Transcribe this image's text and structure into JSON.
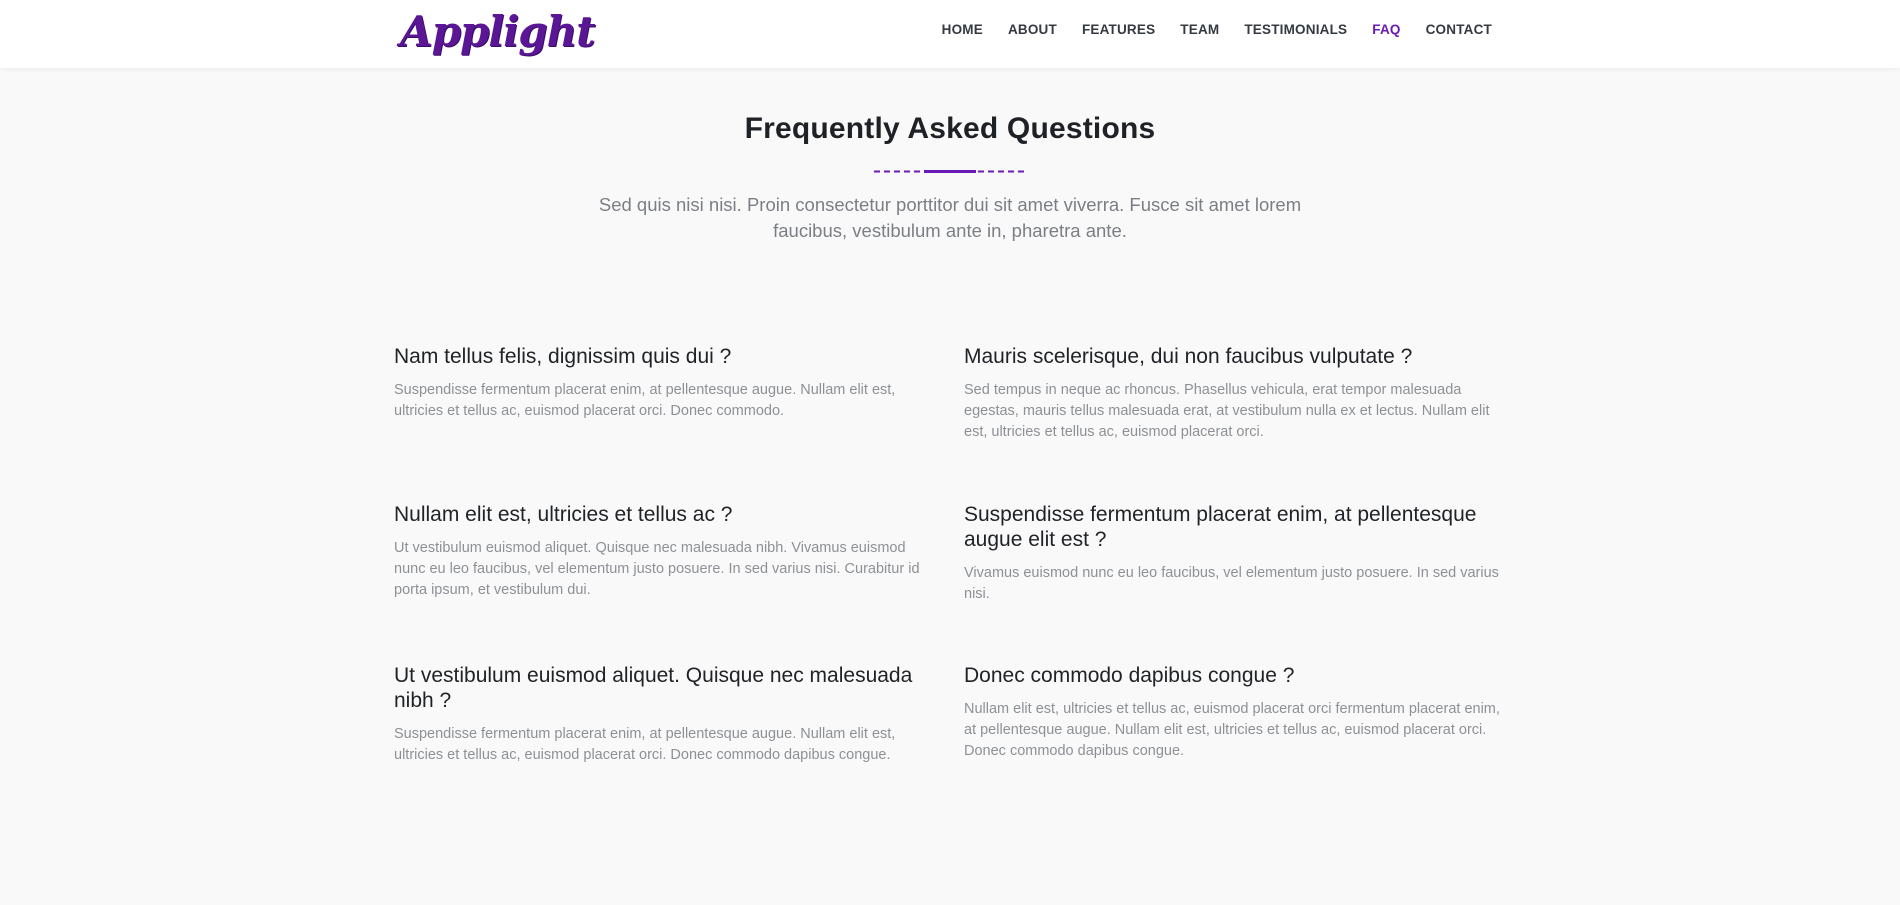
{
  "header": {
    "logo": "Applight",
    "nav": [
      {
        "label": "HOME",
        "active": false
      },
      {
        "label": "ABOUT",
        "active": false
      },
      {
        "label": "FEATURES",
        "active": false
      },
      {
        "label": "TEAM",
        "active": false
      },
      {
        "label": "TESTIMONIALS",
        "active": false
      },
      {
        "label": "FAQ",
        "active": true
      },
      {
        "label": "CONTACT",
        "active": false
      }
    ]
  },
  "colors": {
    "accent": "#6a1bb3",
    "logo": "#5b1696",
    "background": "#f9f9f9",
    "header_bg": "#ffffff",
    "muted_text": "#8d9196"
  },
  "section": {
    "title": "Frequently Asked Questions",
    "subtitle": "Sed quis nisi nisi. Proin consectetur porttitor dui sit amet viverra. Fusce sit amet lorem faucibus, vestibulum ante in, pharetra ante."
  },
  "faqs": [
    {
      "question": "Nam tellus felis, dignissim quis dui ?",
      "answer": "Suspendisse fermentum placerat enim, at pellentesque augue. Nullam elit est, ultricies et tellus ac, euismod placerat orci. Donec commodo."
    },
    {
      "question": "Mauris scelerisque, dui non faucibus vulputate ?",
      "answer": "Sed tempus in neque ac rhoncus. Phasellus vehicula, erat tempor malesuada egestas, mauris tellus malesuada erat, at vestibulum nulla ex et lectus. Nullam elit est, ultricies et tellus ac, euismod placerat orci."
    },
    {
      "question": "Nullam elit est, ultricies et tellus ac ?",
      "answer": "Ut vestibulum euismod aliquet. Quisque nec malesuada nibh. Vivamus euismod nunc eu leo faucibus, vel elementum justo posuere. In sed varius nisi. Curabitur id porta ipsum, et vestibulum dui."
    },
    {
      "question": "Suspendisse fermentum placerat enim, at pellentesque augue elit est ?",
      "answer": "Vivamus euismod nunc eu leo faucibus, vel elementum justo posuere. In sed varius nisi."
    },
    {
      "question": "Ut vestibulum euismod aliquet. Quisque nec malesuada nibh ?",
      "answer": "Suspendisse fermentum placerat enim, at pellentesque augue. Nullam elit est, ultricies et tellus ac, euismod placerat orci. Donec commodo dapibus congue."
    },
    {
      "question": "Donec commodo dapibus congue ?",
      "answer": "Nullam elit est, ultricies et tellus ac, euismod placerat orci fermentum placerat enim, at pellentesque augue. Nullam elit est, ultricies et tellus ac, euismod placerat orci. Donec commodo dapibus congue."
    }
  ]
}
